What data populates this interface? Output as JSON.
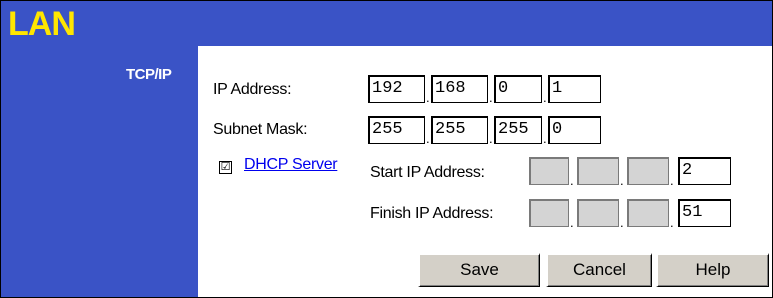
{
  "page": {
    "title": "LAN",
    "section": "TCP/IP"
  },
  "ip_address": {
    "label": "IP Address:",
    "octets": [
      "192",
      "168",
      "0",
      "1"
    ]
  },
  "subnet_mask": {
    "label": "Subnet Mask:",
    "octets": [
      "255",
      "255",
      "255",
      "0"
    ]
  },
  "dhcp": {
    "checkbox_mark": "☑",
    "checked": true,
    "link_label": "DHCP Server",
    "start": {
      "label": "Start IP Address:",
      "last_octet": "2"
    },
    "finish": {
      "label": "Finish IP Address:",
      "last_octet": "51"
    }
  },
  "buttons": {
    "save": "Save",
    "cancel": "Cancel",
    "help": "Help"
  },
  "colors": {
    "banner": "#3a53c6",
    "title_text": "#ffe600",
    "link": "#0000ee"
  }
}
